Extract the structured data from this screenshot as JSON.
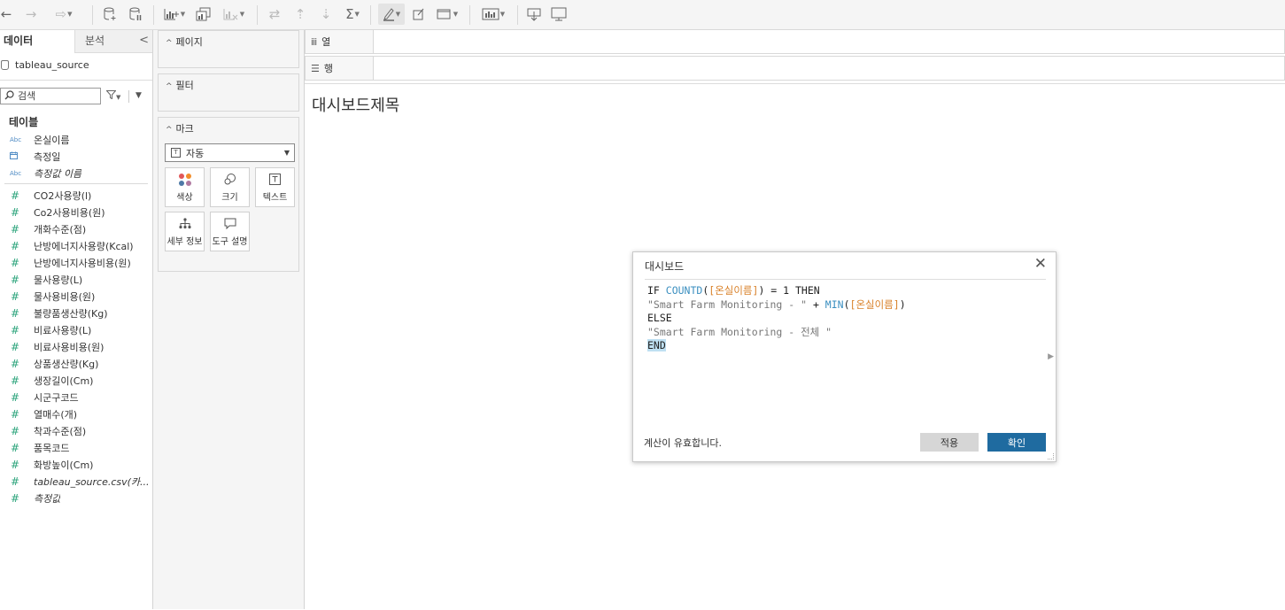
{
  "toolbar": {
    "icons": [
      "undo-icon",
      "redo-icon",
      "replay-icon",
      "new-datasource-icon",
      "pause-updates-icon",
      "new-worksheet-icon",
      "duplicate-icon",
      "clear-sheet-icon",
      "swap-icon",
      "sort-asc-icon",
      "sort-desc-icon",
      "totals-icon",
      "highlight-icon",
      "annotate-icon",
      "fit-icon",
      "show-me-icon",
      "download-icon",
      "presentation-icon"
    ],
    "totals_glyph": "Σ"
  },
  "data_pane": {
    "tab_data": "데이터",
    "tab_analysis": "분석",
    "collapse_glyph": "<",
    "datasource": "tableau_source",
    "search_placeholder": "검색",
    "tables_heading": "테이블",
    "dimensions": [
      {
        "type": "Abc",
        "name": "온실이름",
        "italic": false
      },
      {
        "type": "date",
        "name": "측정일",
        "italic": false
      },
      {
        "type": "Abc",
        "name": "측정값 이름",
        "italic": true
      }
    ],
    "measures": [
      {
        "name": "CO2사용량(l)",
        "italic": false
      },
      {
        "name": "Co2사용비용(원)",
        "italic": false
      },
      {
        "name": "개화수준(점)",
        "italic": false
      },
      {
        "name": "난방에너지사용량(Kcal)",
        "italic": false
      },
      {
        "name": "난방에너지사용비용(원)",
        "italic": false
      },
      {
        "name": "물사용량(L)",
        "italic": false
      },
      {
        "name": "물사용비용(원)",
        "italic": false
      },
      {
        "name": "불량품생산량(Kg)",
        "italic": false
      },
      {
        "name": "비료사용량(L)",
        "italic": false
      },
      {
        "name": "비료사용비용(원)",
        "italic": false
      },
      {
        "name": "상품생산량(Kg)",
        "italic": false
      },
      {
        "name": "생장길이(Cm)",
        "italic": false
      },
      {
        "name": "시군구코드",
        "italic": false
      },
      {
        "name": "열매수(개)",
        "italic": false
      },
      {
        "name": "착과수준(점)",
        "italic": false
      },
      {
        "name": "품목코드",
        "italic": false
      },
      {
        "name": "화방높이(Cm)",
        "italic": false
      },
      {
        "name": "tableau_source.csv(카...",
        "italic": true
      },
      {
        "name": "측정값",
        "italic": true
      }
    ],
    "abc_glyph": "Abc",
    "number_glyph": "#"
  },
  "cards": {
    "pages": "페이지",
    "filters": "필터",
    "marks": "마크",
    "mark_type": "자동",
    "buttons": {
      "color": "색상",
      "size": "크기",
      "text": "텍스트",
      "detail": "세부 정보",
      "tooltip": "도구 설명"
    },
    "dot_colors": [
      "#e15759",
      "#f28e2b",
      "#4e79a7",
      "#b07aa1"
    ]
  },
  "shelves": {
    "columns": "열",
    "rows": "행"
  },
  "canvas": {
    "title": "대시보드제목"
  },
  "dialog": {
    "title": "대시보드",
    "close": "✕",
    "code": {
      "l1_if": "IF ",
      "l1_fn": "COUNTD",
      "l1_open": "(",
      "l1_field": "[온실이름]",
      "l1_rest": ") = 1 THEN",
      "l2_str": "\"Smart Farm Monitoring - \"",
      "l2_plus": " + ",
      "l2_fn": "MIN",
      "l2_open": "(",
      "l2_field": "[온실이름]",
      "l2_close": ")",
      "l3": "ELSE",
      "l4_str": "\"Smart Farm Monitoring - 전체 \"",
      "l5": "END"
    },
    "status": "계산이 유효합니다.",
    "apply": "적용",
    "ok": "확인"
  }
}
